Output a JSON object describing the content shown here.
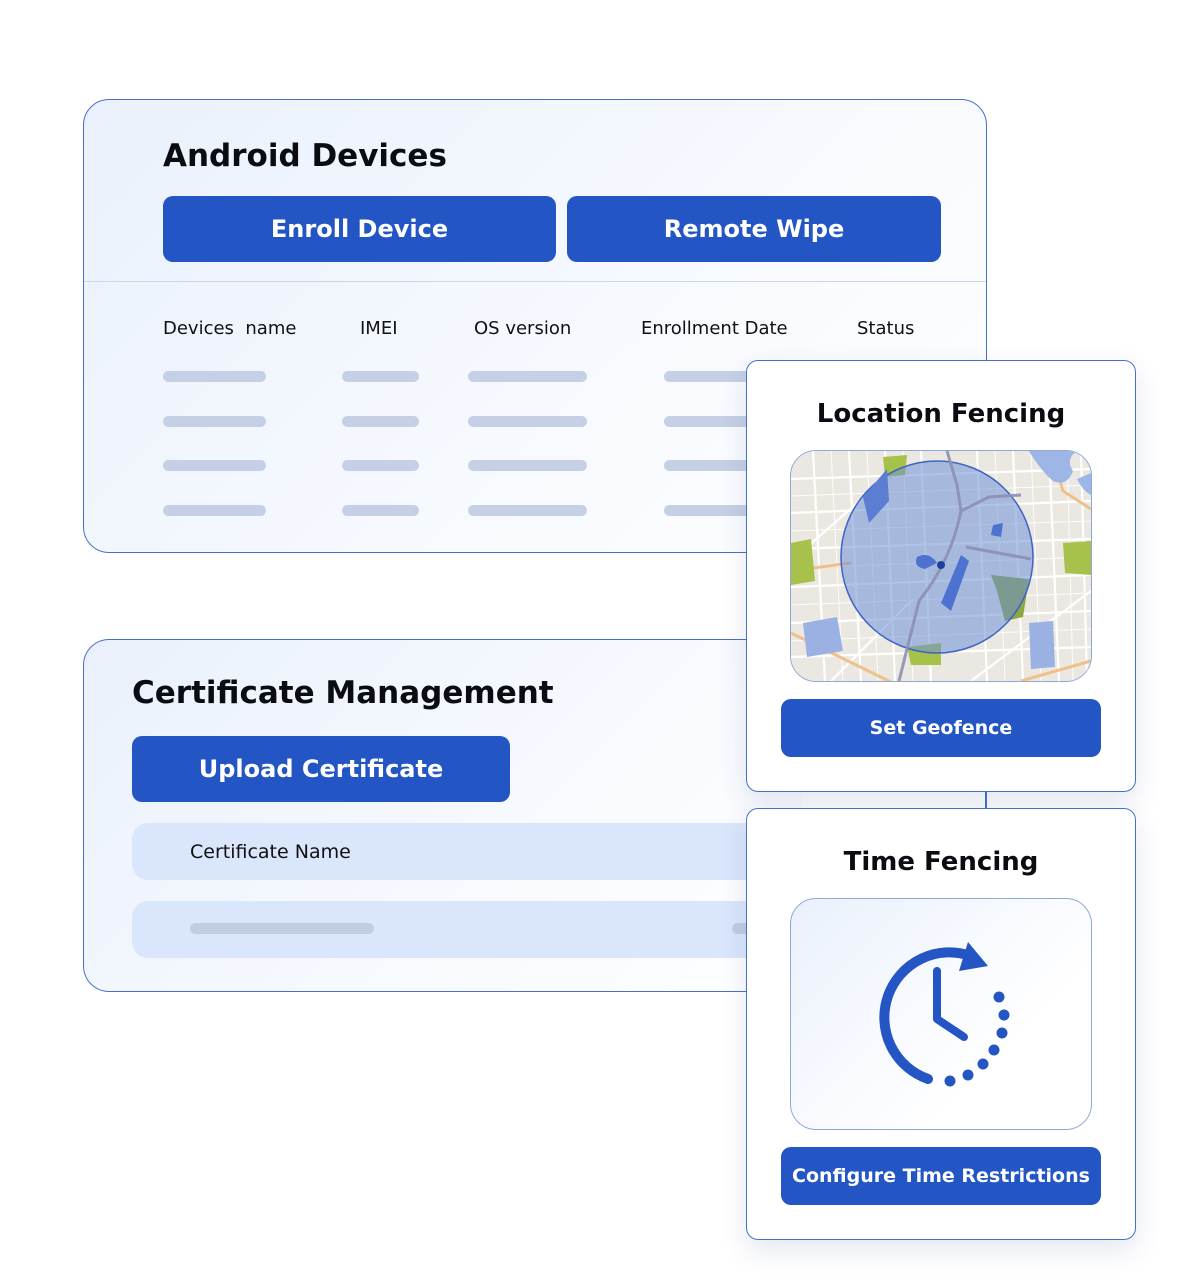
{
  "android": {
    "title": "Android Devices",
    "enroll_label": "Enroll Device",
    "wipe_label": "Remote Wipe",
    "columns": [
      "Devices  name",
      "IMEI",
      "OS version",
      "Enrollment Date",
      "Status"
    ]
  },
  "certificates": {
    "title": "Certificate Management",
    "upload_label": "Upload Certificate",
    "column_header": "Certificate Name"
  },
  "location": {
    "title": "Location Fencing",
    "button_label": "Set Geofence"
  },
  "time": {
    "title": "Time Fencing",
    "button_label": "Configure Time Restrictions"
  },
  "colors": {
    "primary": "#2356c4",
    "border": "#4a6fc9",
    "placeholder": "#c5d0e6",
    "row_fill": "#dae6fb"
  },
  "icons": [
    "map-icon",
    "clock-icon"
  ]
}
